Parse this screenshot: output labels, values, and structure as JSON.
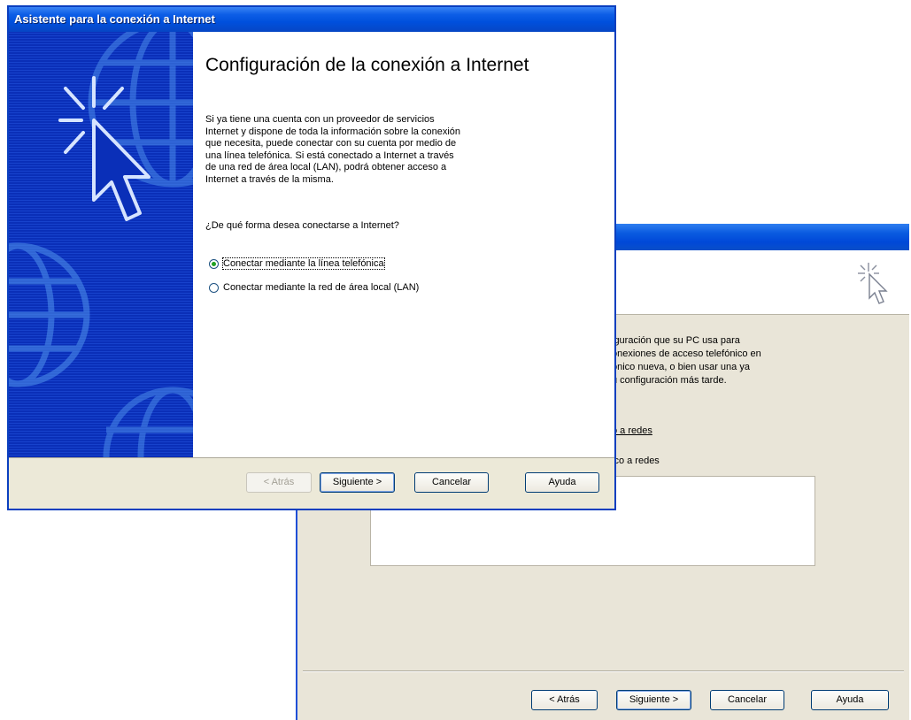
{
  "back_window": {
    "body_lines": [
      "iguración que su PC usa para",
      "onexiones de acceso telefónico en",
      "ónico nueva, o bien usar una ya",
      "u configuración más tarde."
    ],
    "option1": "o a redes",
    "option2": "ico a redes",
    "buttons": {
      "back": "< Atrás",
      "next": "Siguiente >",
      "cancel": "Cancelar",
      "help": "Ayuda"
    }
  },
  "front_window": {
    "title": "Asistente para la conexión a Internet",
    "heading": "Configuración de la conexión a Internet",
    "description_lines": [
      "Si ya tiene una cuenta con un proveedor de servicios",
      "Internet y dispone de toda la información sobre la conexión",
      "que necesita, puede conectar con su cuenta por medio de",
      "una línea telefónica. Si está conectado a Internet a través",
      "de una red de área local (LAN), podrá obtener acceso a",
      "Internet a través de la misma."
    ],
    "question": "¿De qué forma desea conectarse a Internet?",
    "options": [
      {
        "label": "Conectar mediante la línea telefónica",
        "selected": true
      },
      {
        "label": "Conectar mediante la red de área local (LAN)",
        "selected": false
      }
    ],
    "buttons": {
      "back": "< Atrás",
      "next": "Siguiente >",
      "cancel": "Cancelar",
      "help": "Ayuda"
    }
  }
}
